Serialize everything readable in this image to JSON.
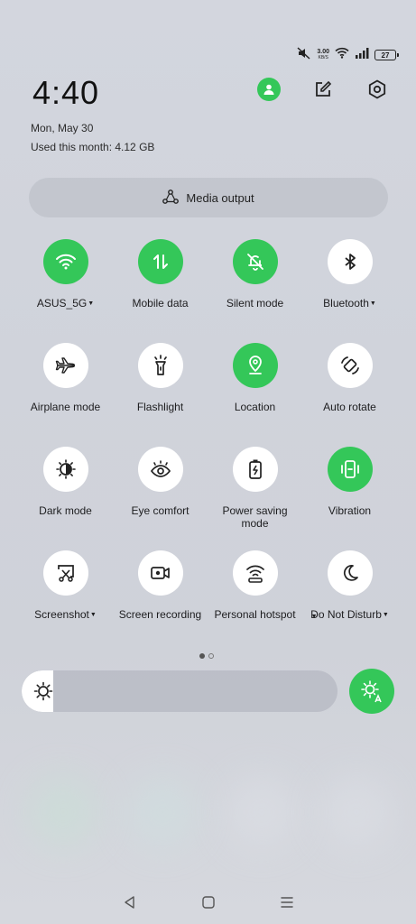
{
  "status_bar": {
    "net_speed": "3.00",
    "net_unit": "KB/S",
    "battery": "27",
    "icons": [
      "mute-icon",
      "wifi-icon",
      "signal-icon",
      "battery-icon"
    ]
  },
  "header": {
    "time": "4:40",
    "date": "Mon, May 30",
    "usage": "Used this month: 4.12 GB",
    "icons": [
      "user-avatar-icon",
      "edit-icon",
      "settings-icon"
    ]
  },
  "media_output": {
    "label": "Media output",
    "icon": "media-output-icon"
  },
  "tiles": [
    {
      "label": "ASUS_5G",
      "icon": "wifi-icon",
      "on": true,
      "dropdown": true
    },
    {
      "label": "Mobile data",
      "icon": "mobile-data-icon",
      "on": true,
      "dropdown": false
    },
    {
      "label": "Silent mode",
      "icon": "silent-bell-icon",
      "on": true,
      "dropdown": false
    },
    {
      "label": "Bluetooth",
      "icon": "bluetooth-icon",
      "on": false,
      "dropdown": true
    },
    {
      "label": "Airplane mode",
      "icon": "airplane-icon",
      "on": false,
      "dropdown": false
    },
    {
      "label": "Flashlight",
      "icon": "flashlight-icon",
      "on": false,
      "dropdown": false
    },
    {
      "label": "Location",
      "icon": "location-icon",
      "on": true,
      "dropdown": false
    },
    {
      "label": "Auto rotate",
      "icon": "auto-rotate-icon",
      "on": false,
      "dropdown": false
    },
    {
      "label": "Dark mode",
      "icon": "dark-mode-icon",
      "on": false,
      "dropdown": false
    },
    {
      "label": "Eye comfort",
      "icon": "eye-icon",
      "on": false,
      "dropdown": false
    },
    {
      "label": "Power saving mode",
      "icon": "battery-saver-icon",
      "on": false,
      "dropdown": false
    },
    {
      "label": "Vibration",
      "icon": "vibration-icon",
      "on": true,
      "dropdown": false
    },
    {
      "label": "Screenshot",
      "icon": "screenshot-icon",
      "on": false,
      "dropdown": true
    },
    {
      "label": "Screen recording",
      "icon": "screen-record-icon",
      "on": false,
      "dropdown": false
    },
    {
      "label": "Personal hotspot",
      "icon": "hotspot-icon",
      "on": false,
      "dropdown": true
    },
    {
      "label": "Do Not Disturb",
      "icon": "moon-icon",
      "on": false,
      "dropdown": true
    }
  ],
  "pager": {
    "pages": 2,
    "current": 1
  },
  "brightness": {
    "level": 0.1,
    "icon": "brightness-icon",
    "auto_icon": "auto-brightness-icon"
  },
  "nav": [
    "back-icon",
    "home-icon",
    "recents-icon"
  ],
  "colors": {
    "accent": "#34c759",
    "tile_off": "#ffffff"
  }
}
